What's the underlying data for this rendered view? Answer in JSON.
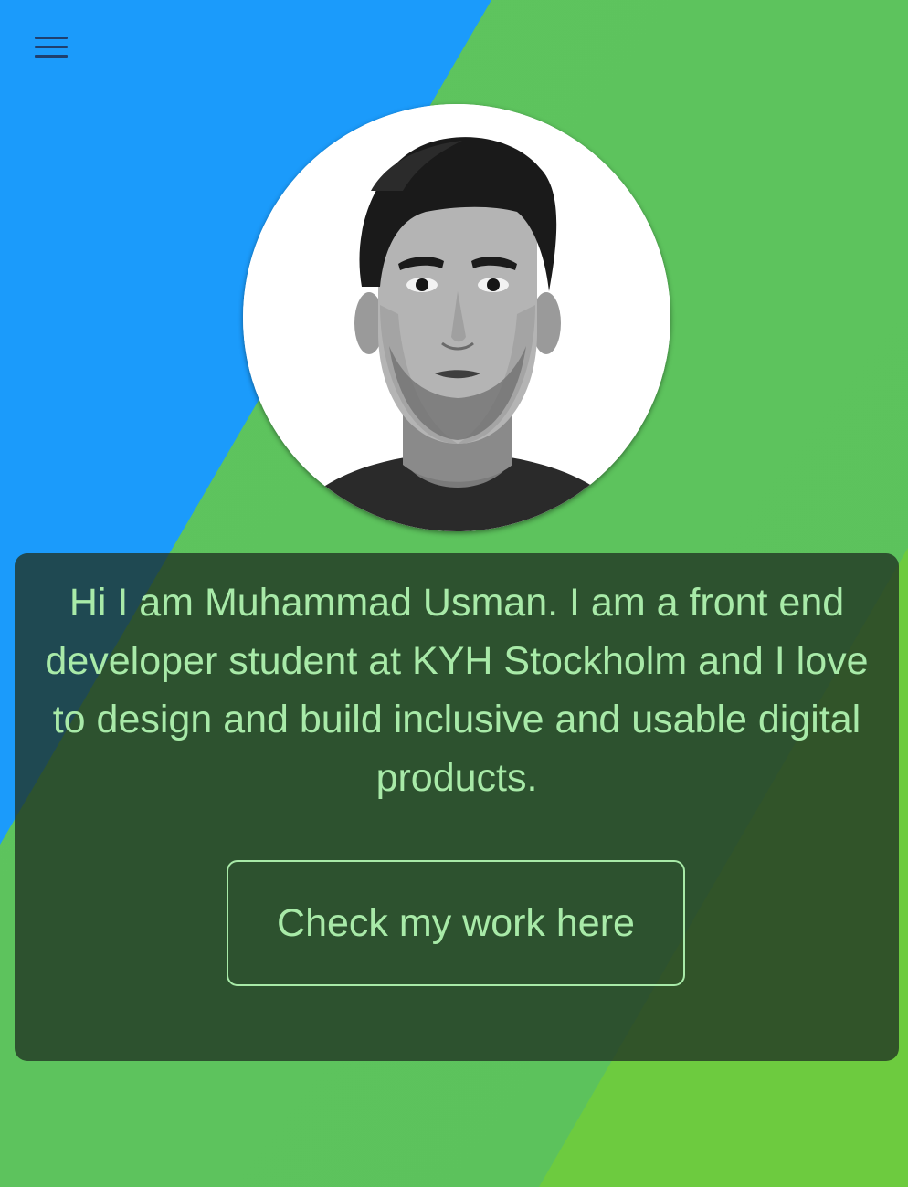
{
  "header": {
    "menu_icon": "hamburger-menu-icon"
  },
  "profile": {
    "photo_alt": "Portrait of Muhammad Usman"
  },
  "hero": {
    "intro_text": "Hi I am Muhammad Usman. I am a front end developer student at KYH Stockholm and I love to design and build inclusive and usable digital products.",
    "cta_label": "Check my work here"
  },
  "colors": {
    "background_blue": "#1b9bfb",
    "background_green": "#5ec45e",
    "background_green_light": "#6dcb3f",
    "text_accent": "#a8eaa8",
    "menu_icon": "#1f3f6e"
  }
}
